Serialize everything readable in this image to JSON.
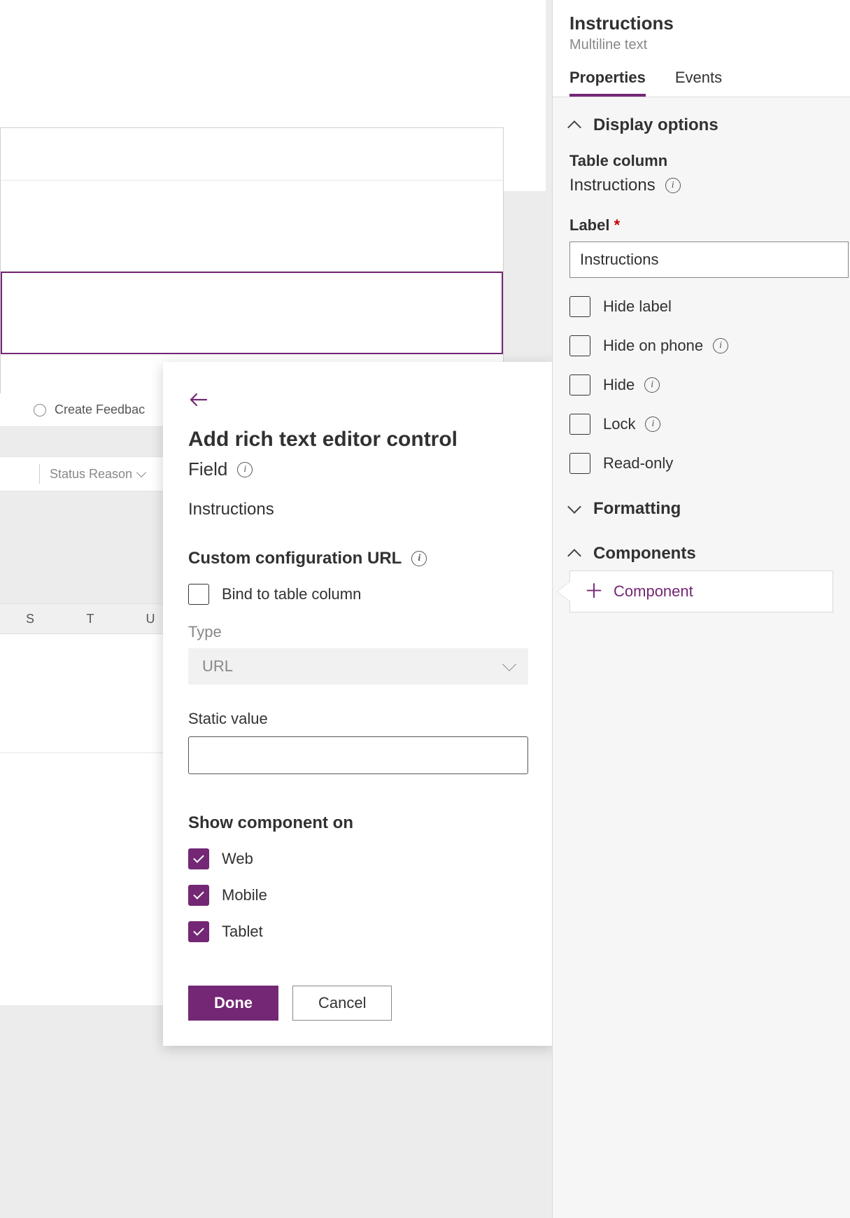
{
  "background": {
    "action_label": "Create Feedbac",
    "sub_label": "Status Reason",
    "letters": [
      "S",
      "T",
      "U"
    ]
  },
  "modal": {
    "title": "Add rich text editor control",
    "field_label": "Field",
    "field_value": "Instructions",
    "config_label": "Custom configuration URL",
    "bind_label": "Bind to table column",
    "type_label": "Type",
    "type_value": "URL",
    "static_label": "Static value",
    "static_value": "",
    "show_label": "Show component on",
    "platforms": [
      {
        "label": "Web",
        "checked": true
      },
      {
        "label": "Mobile",
        "checked": true
      },
      {
        "label": "Tablet",
        "checked": true
      }
    ],
    "done": "Done",
    "cancel": "Cancel"
  },
  "panel": {
    "title": "Instructions",
    "subtitle": "Multiline text",
    "tabs": {
      "properties": "Properties",
      "events": "Events"
    },
    "display_options": "Display options",
    "table_column_label": "Table column",
    "table_column_value": "Instructions",
    "label_label": "Label",
    "label_value": "Instructions",
    "hide_label": "Hide label",
    "hide_phone": "Hide on phone",
    "hide": "Hide",
    "lock": "Lock",
    "readonly": "Read-only",
    "formatting": "Formatting",
    "components": "Components",
    "add_component": "Component"
  }
}
